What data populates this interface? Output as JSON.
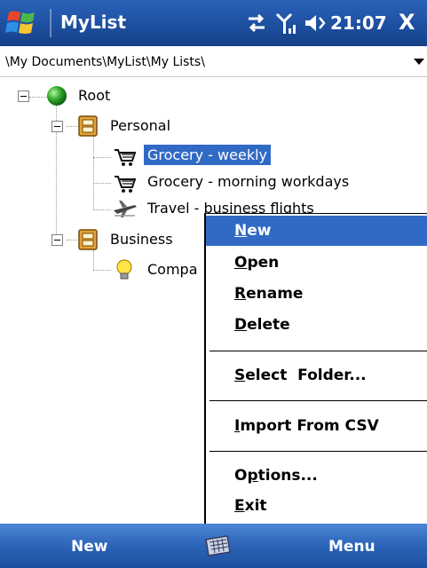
{
  "app": {
    "title": "MyList",
    "time": "21:07",
    "close_label": "X"
  },
  "status_icons": [
    "sync-icon",
    "signal-icon",
    "volume-icon"
  ],
  "path": {
    "value": "\\My Documents\\MyList\\My Lists\\"
  },
  "tree": {
    "root": {
      "label": "Root"
    },
    "personal": {
      "label": "Personal"
    },
    "grocery_weekly": {
      "label": "Grocery - weekly"
    },
    "grocery_morning": {
      "label": "Grocery - morning workdays"
    },
    "travel": {
      "label": "Travel - business flights"
    },
    "business": {
      "label": "Business"
    },
    "company": {
      "label": "Compa"
    }
  },
  "menu": {
    "items": [
      {
        "pre": "",
        "key": "N",
        "post": "ew"
      },
      {
        "pre": "",
        "key": "O",
        "post": "pen"
      },
      {
        "pre": "",
        "key": "R",
        "post": "ename"
      },
      {
        "pre": "",
        "key": "D",
        "post": "elete"
      },
      {
        "pre": "",
        "key": "S",
        "post": "elect  Folder..."
      },
      {
        "pre": "",
        "key": "I",
        "post": "mport From CSV"
      },
      {
        "pre": "O",
        "key": "p",
        "post": "tions..."
      },
      {
        "pre": "",
        "key": "E",
        "post": "xit"
      }
    ]
  },
  "softkeys": {
    "left": "New",
    "right": "Menu"
  },
  "colors": {
    "title_bar": "#1d4fa0",
    "selection": "#316ac5",
    "softkey_bar": "#2b64b8"
  }
}
